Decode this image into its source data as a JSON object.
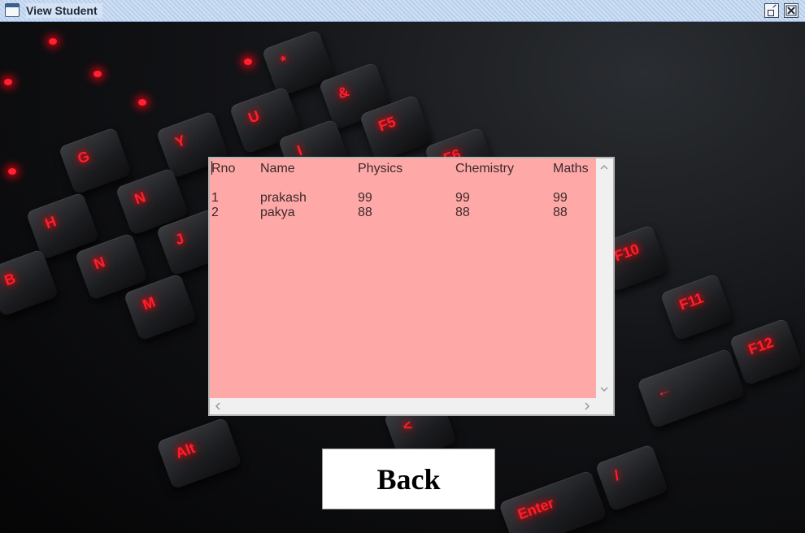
{
  "window": {
    "title": "View Student"
  },
  "table": {
    "headers": [
      "Rno",
      "Name",
      "Physics",
      "Chemistry",
      "Maths"
    ],
    "rows": [
      [
        "1",
        "prakash",
        "99",
        "99",
        "99"
      ],
      [
        "2",
        "pakya",
        "88",
        "88",
        "88"
      ]
    ]
  },
  "back_button": {
    "label": "Back"
  },
  "colors": {
    "table_background": "#ffa8a8",
    "key_glow": "#ff1f2a"
  },
  "icons": {
    "app": "window-icon",
    "restore": "restore-icon",
    "close": "close-icon",
    "scroll_up": "chevron-up-icon",
    "scroll_down": "chevron-down-icon",
    "scroll_left": "chevron-left-icon",
    "scroll_right": "chevron-right-icon"
  }
}
